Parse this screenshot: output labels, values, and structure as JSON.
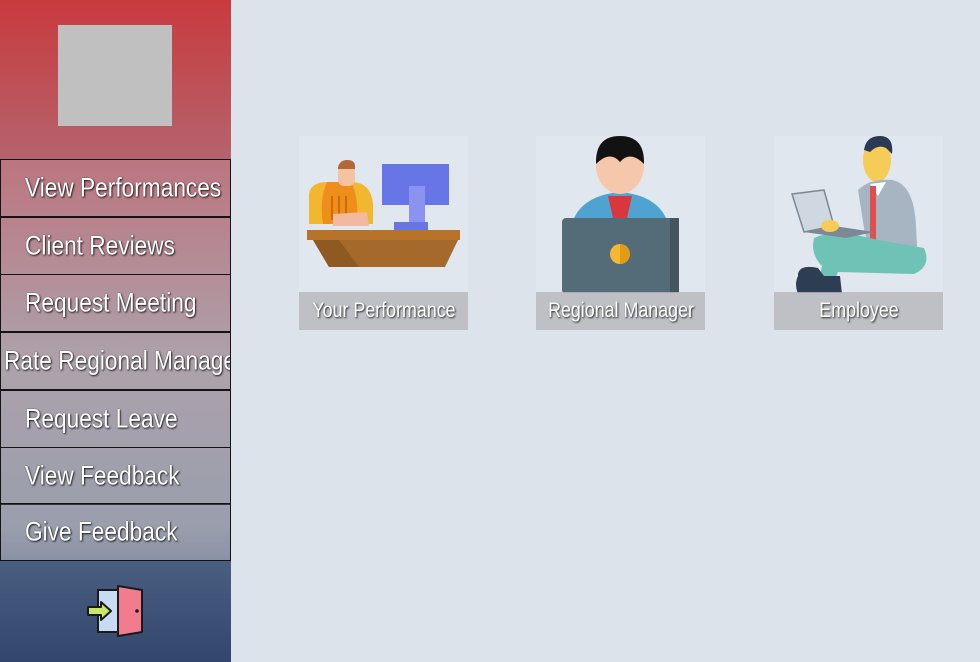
{
  "sidebar": {
    "logo_icon": "image-placeholder",
    "items": [
      {
        "label": "View Performances"
      },
      {
        "label": "Client Reviews"
      },
      {
        "label": "Request Meeting"
      },
      {
        "label": "Rate Regional Manager"
      },
      {
        "label": "Request Leave"
      },
      {
        "label": "View Feedback"
      },
      {
        "label": "Give Feedback"
      }
    ],
    "logout_icon": "logout-door-icon"
  },
  "cards": [
    {
      "label": "Your Performance",
      "icon": "desk-worker-illustration"
    },
    {
      "label": "Regional Manager",
      "icon": "manager-laptop-illustration"
    },
    {
      "label": "Employee",
      "icon": "employee-laptop-illustration"
    }
  ],
  "colors": {
    "background": "#dce3ea",
    "sidebar_top": "#c93a3e",
    "sidebar_bottom": "#3f5378"
  }
}
